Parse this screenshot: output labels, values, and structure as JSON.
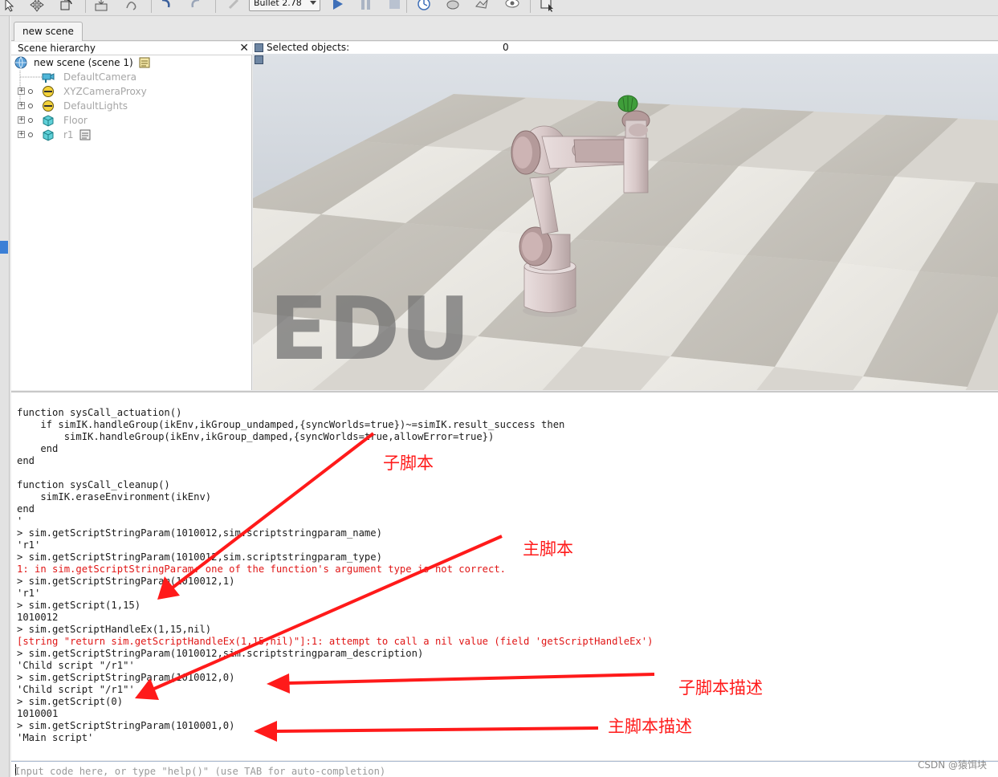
{
  "toolbar": {
    "physics_engine": "Bullet 2.78"
  },
  "tab": {
    "label": "new scene"
  },
  "hierarchy": {
    "title": "Scene hierarchy",
    "close": "✕",
    "root": "new scene (scene 1)",
    "items": [
      {
        "label": "DefaultCamera",
        "icon": "camera-icon"
      },
      {
        "label": "XYZCameraProxy",
        "icon": "dummy-icon"
      },
      {
        "label": "DefaultLights",
        "icon": "light-icon"
      },
      {
        "label": "Floor",
        "icon": "shape-icon"
      },
      {
        "label": "r1",
        "icon": "shape-icon"
      }
    ]
  },
  "viewport": {
    "selected_label": "Selected objects:",
    "selected_count": "0",
    "watermark": "EDU"
  },
  "console": {
    "lines": [
      {
        "t": "function sysCall_actuation()",
        "c": "normal"
      },
      {
        "t": "    if simIK.handleGroup(ikEnv,ikGroup_undamped,{syncWorlds=true})~=simIK.result_success then",
        "c": "normal"
      },
      {
        "t": "        simIK.handleGroup(ikEnv,ikGroup_damped,{syncWorlds=true,allowError=true})",
        "c": "normal"
      },
      {
        "t": "    end",
        "c": "normal"
      },
      {
        "t": "end",
        "c": "normal"
      },
      {
        "t": "",
        "c": "normal"
      },
      {
        "t": "function sysCall_cleanup()",
        "c": "normal"
      },
      {
        "t": "    simIK.eraseEnvironment(ikEnv)",
        "c": "normal"
      },
      {
        "t": "end",
        "c": "normal"
      },
      {
        "t": "'",
        "c": "normal"
      },
      {
        "t": "> sim.getScriptStringParam(1010012,sim.scriptstringparam_name)",
        "c": "normal"
      },
      {
        "t": "'r1'",
        "c": "normal"
      },
      {
        "t": "> sim.getScriptStringParam(1010012,sim.scriptstringparam_type)",
        "c": "normal"
      },
      {
        "t": "1: in sim.getScriptStringParam: one of the function's argument type is not correct.",
        "c": "err"
      },
      {
        "t": "> sim.getScriptStringParam(1010012,1)",
        "c": "normal"
      },
      {
        "t": "'r1'",
        "c": "normal"
      },
      {
        "t": "> sim.getScript(1,15)",
        "c": "normal"
      },
      {
        "t": "1010012",
        "c": "normal"
      },
      {
        "t": "> sim.getScriptHandleEx(1,15,nil)",
        "c": "normal"
      },
      {
        "t": "[string \"return sim.getScriptHandleEx(1,15,nil)\"]:1: attempt to call a nil value (field 'getScriptHandleEx')",
        "c": "err"
      },
      {
        "t": "> sim.getScriptStringParam(1010012,sim.scriptstringparam_description)",
        "c": "normal"
      },
      {
        "t": "'Child script \"/r1\"'",
        "c": "normal"
      },
      {
        "t": "> sim.getScriptStringParam(1010012,0)",
        "c": "normal"
      },
      {
        "t": "'Child script \"/r1\"'",
        "c": "normal"
      },
      {
        "t": "> sim.getScript(0)",
        "c": "normal"
      },
      {
        "t": "1010001",
        "c": "normal"
      },
      {
        "t": "> sim.getScriptStringParam(1010001,0)",
        "c": "normal"
      },
      {
        "t": "'Main script'",
        "c": "normal"
      }
    ],
    "input_placeholder": "Input code here, or type \"help()\" (use TAB for auto-completion)"
  },
  "annotations": {
    "child_script": "子脚本",
    "main_script": "主脚本",
    "child_script_desc": "子脚本描述",
    "main_script_desc": "主脚本描述"
  },
  "footer": {
    "watermark": "CSDN @猿饵块"
  },
  "colors": {
    "annotation": "#ff1a1a",
    "error_text": "#e01515"
  }
}
